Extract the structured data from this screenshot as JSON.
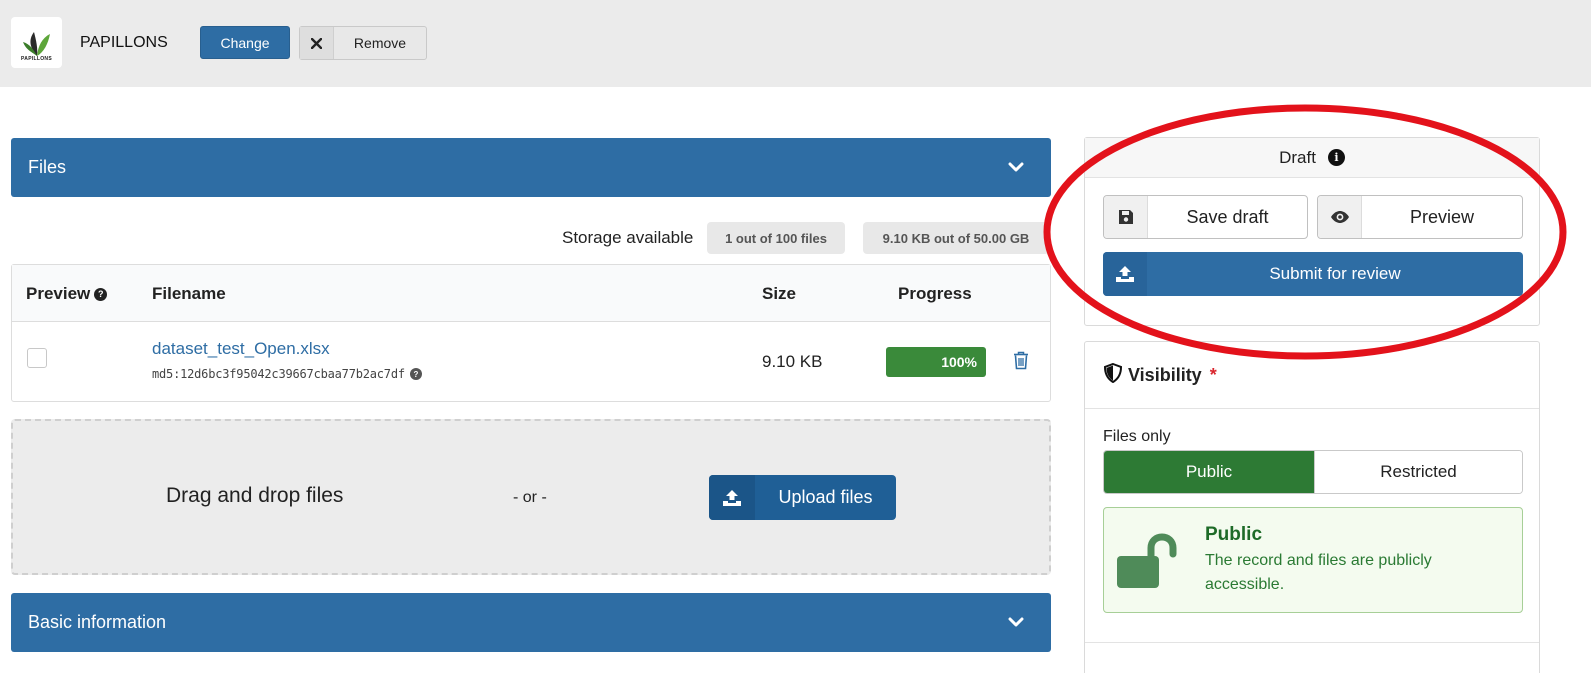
{
  "topbar": {
    "logo_text": "PAPILLONS",
    "community_name": "PAPILLONS",
    "change_label": "Change",
    "remove_label": "Remove"
  },
  "files": {
    "section_title": "Files",
    "storage_label": "Storage available",
    "files_badge": "1 out of 100 files",
    "size_badge": "9.10 KB out of 50.00 GB",
    "columns": {
      "preview": "Preview",
      "filename": "Filename",
      "size": "Size",
      "progress": "Progress"
    },
    "rows": [
      {
        "filename": "dataset_test_Open.xlsx",
        "md5": "md5:12d6bc3f95042c39667cbaa77b2ac7df",
        "size": "9.10 KB",
        "progress": 1.0,
        "progress_label": "100%"
      }
    ],
    "dropzone_text": "Drag and drop files",
    "or_text": "- or -",
    "upload_label": "Upload files"
  },
  "basic_info": {
    "section_title": "Basic information"
  },
  "draft": {
    "title": "Draft",
    "save_label": "Save draft",
    "preview_label": "Preview",
    "submit_label": "Submit for review"
  },
  "visibility": {
    "title": "Visibility",
    "required_mark": "*",
    "files_only_label": "Files only",
    "public_label": "Public",
    "restricted_label": "Restricted",
    "message_title": "Public",
    "message_text": "The record and files are publicly accessible."
  },
  "colors": {
    "primary": "#2e6da4",
    "success": "#2d7a34",
    "annotation": "#e3121b",
    "required": "#d9262e"
  },
  "icons": {
    "remove": "close-icon",
    "trash": "trash-icon",
    "upload": "upload-icon",
    "save": "floppy-disk-icon",
    "preview": "eye-icon",
    "info": "info-icon",
    "visibility": "shield-icon",
    "unlock": "unlock-icon",
    "chevron": "chevron-down-icon"
  }
}
